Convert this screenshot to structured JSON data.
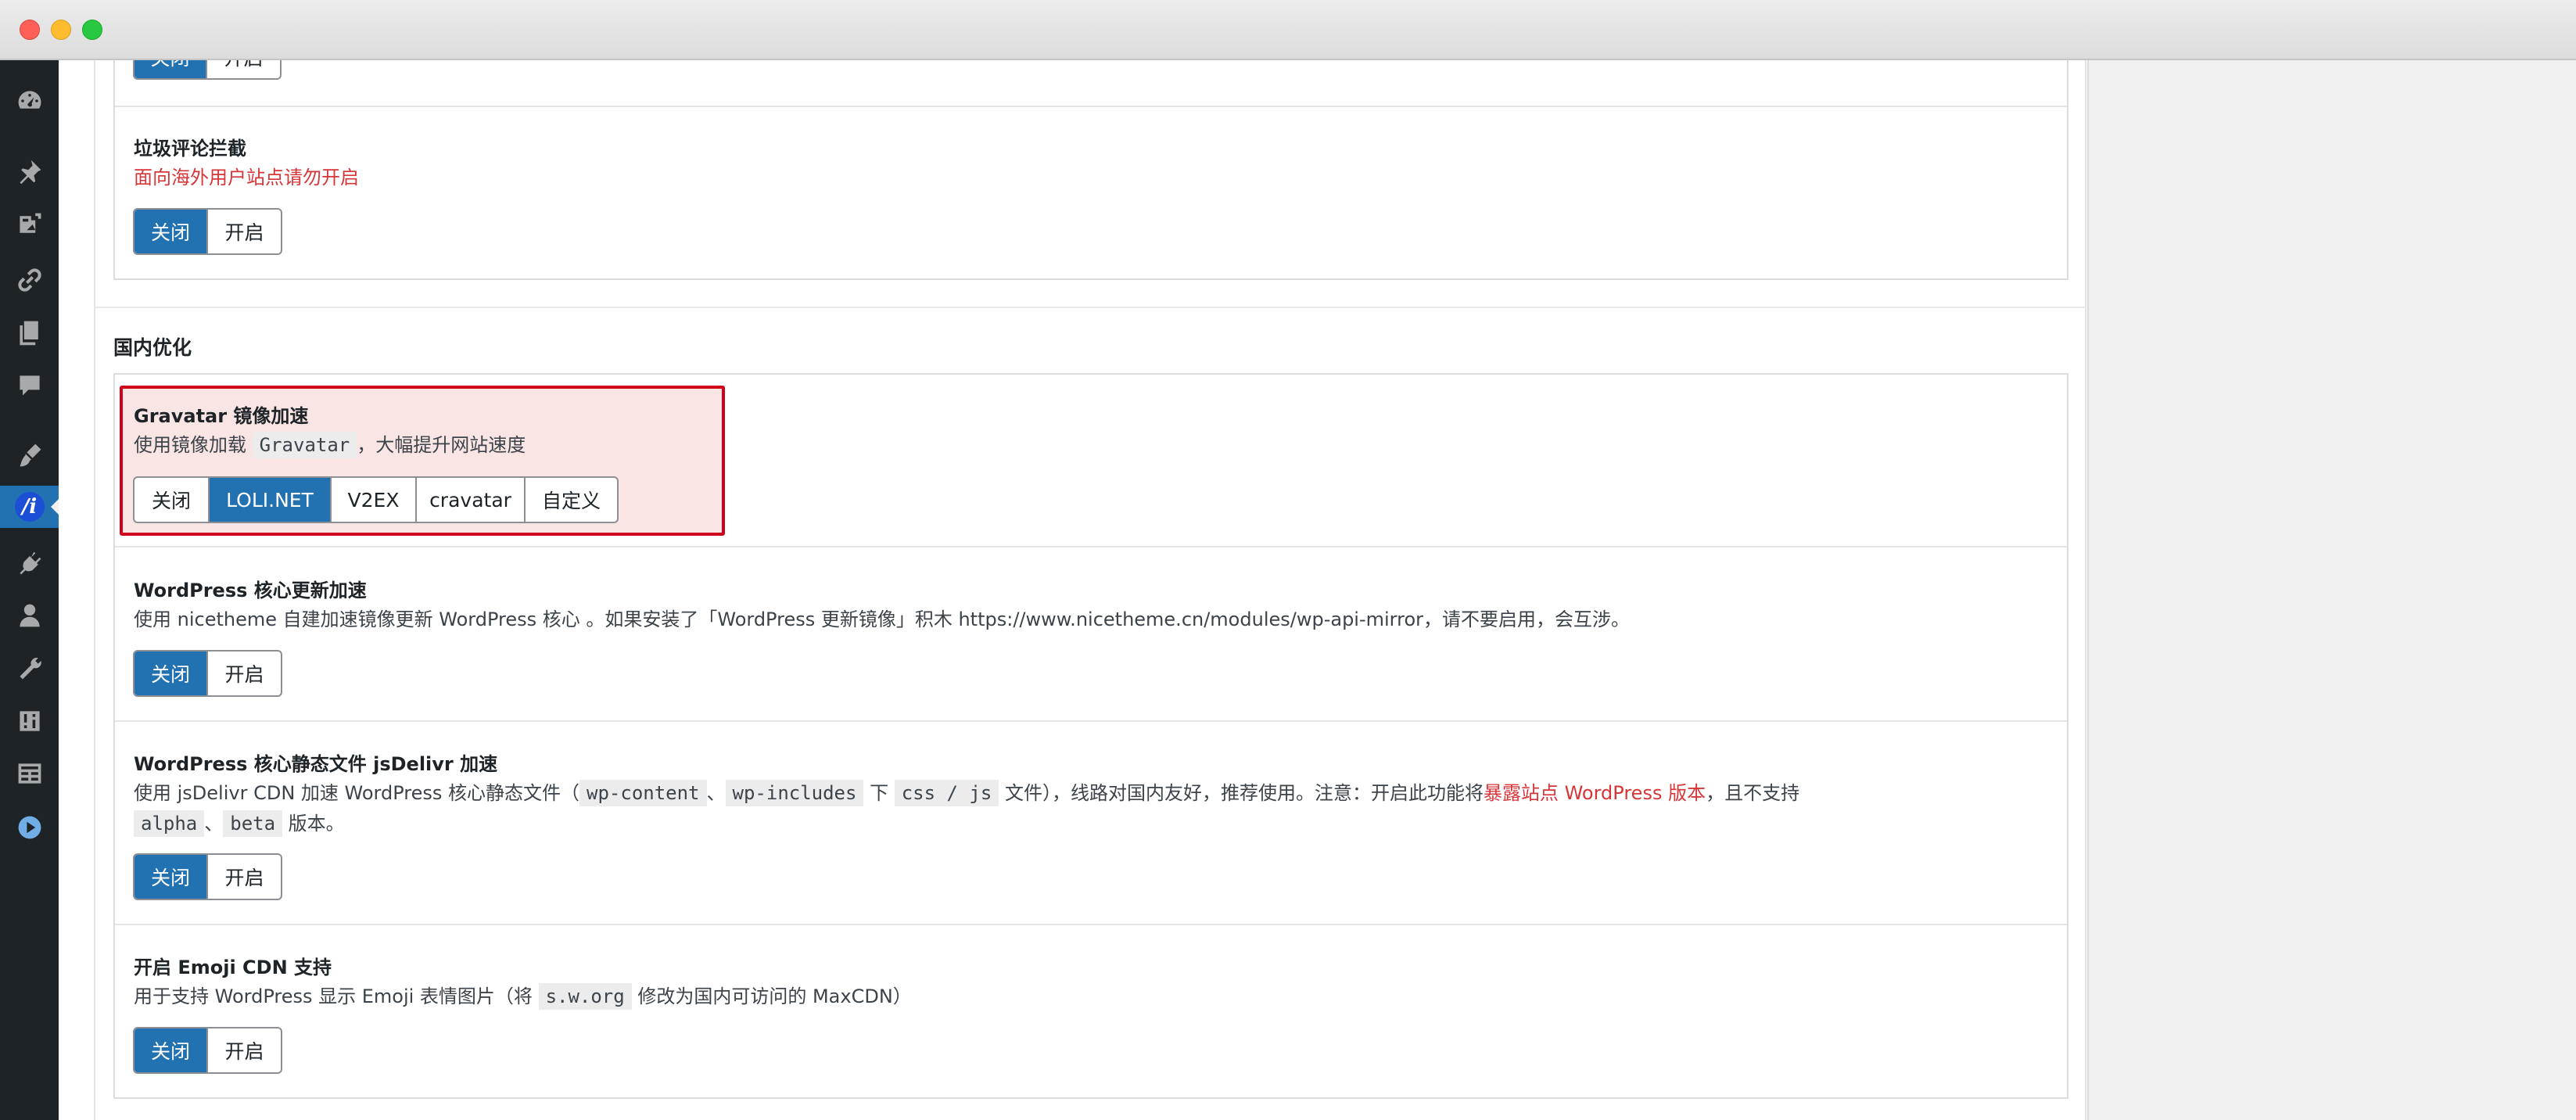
{
  "sidebar": {
    "items": [
      {
        "icon": "dashboard-icon"
      },
      {
        "icon": "pin-icon"
      },
      {
        "icon": "media-icon"
      },
      {
        "icon": "link-icon"
      },
      {
        "icon": "pages-icon"
      },
      {
        "icon": "comments-icon"
      },
      {
        "icon": "appearance-icon"
      },
      {
        "icon": "theme-logo-icon",
        "logo_text": "/i",
        "active": true
      },
      {
        "icon": "plugins-icon"
      },
      {
        "icon": "users-icon"
      },
      {
        "icon": "tools-icon"
      },
      {
        "icon": "settings-icon"
      },
      {
        "icon": "table-icon"
      },
      {
        "icon": "play-icon"
      }
    ]
  },
  "top_partial": {
    "options": [
      "关闭",
      "开启"
    ]
  },
  "spam": {
    "title": "垃圾评论拦截",
    "warning": "面向海外用户站点请勿开启",
    "options": [
      "关闭",
      "开启"
    ],
    "selected": 0
  },
  "section": {
    "title": "国内优化"
  },
  "gravatar": {
    "title": "Gravatar 镜像加速",
    "desc_before": "使用镜像加载 ",
    "desc_code": "Gravatar",
    "desc_after": "，大幅提升网站速度",
    "options": [
      "关闭",
      "LOLI.NET",
      "V2EX",
      "cravatar",
      "自定义"
    ],
    "selected": 1
  },
  "core_update": {
    "title": "WordPress 核心更新加速",
    "desc": "使用 nicetheme 自建加速镜像更新 WordPress 核心 。如果安装了「WordPress 更新镜像」积木 https://www.nicetheme.cn/modules/wp-api-mirror，请不要启用，会互涉。",
    "options": [
      "关闭",
      "开启"
    ],
    "selected": 0
  },
  "jsdelivr": {
    "title": "WordPress 核心静态文件 jsDelivr 加速",
    "desc_part1": "使用 jsDelivr CDN 加速 WordPress 核心静态文件（",
    "code1": "wp-content",
    "sep1": "、",
    "code2": "wp-includes",
    "desc_part2": " 下 ",
    "code3": "css / js",
    "desc_part3": " 文件），线路对国内友好，推荐使用。注意：开启此功能将",
    "desc_red": "暴露站点 WordPress 版本",
    "desc_part4": "，且不支持",
    "code4": "alpha",
    "sep2": "、",
    "code5": "beta",
    "desc_part5": " 版本。",
    "options": [
      "关闭",
      "开启"
    ],
    "selected": 0
  },
  "emoji": {
    "title": "开启 Emoji CDN 支持",
    "desc_part1": "用于支持 WordPress 显示 Emoji 表情图片（将 ",
    "code1": "s.w.org",
    "desc_part2": " 修改为国内可访问的 MaxCDN）",
    "options": [
      "关闭",
      "开启"
    ],
    "selected": 0
  },
  "colors": {
    "accent": "#2271b1",
    "warning": "#d63638",
    "highlight_border": "#d0021b",
    "sidebar_bg": "#1d2327"
  }
}
